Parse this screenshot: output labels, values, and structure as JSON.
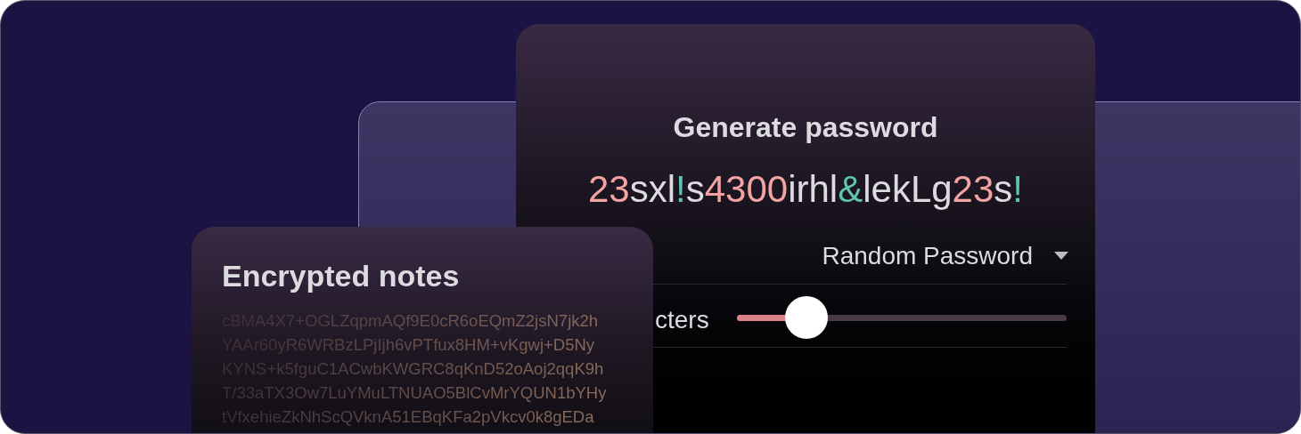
{
  "generator": {
    "title": "Generate password",
    "password": [
      {
        "text": "23",
        "kind": "digit"
      },
      {
        "text": "sxl",
        "kind": "letter"
      },
      {
        "text": "!",
        "kind": "symbol"
      },
      {
        "text": "s",
        "kind": "letter"
      },
      {
        "text": "4300",
        "kind": "digit"
      },
      {
        "text": "irhl",
        "kind": "letter"
      },
      {
        "text": "&",
        "kind": "symbol"
      },
      {
        "text": "lekLg",
        "kind": "letter"
      },
      {
        "text": "23",
        "kind": "digit"
      },
      {
        "text": "s",
        "kind": "letter"
      },
      {
        "text": "!",
        "kind": "symbol"
      }
    ],
    "type_select": {
      "value": "Random Password"
    },
    "length": {
      "label": "cters",
      "level": 0.21
    }
  },
  "notes": {
    "title": "Encrypted notes",
    "lines": [
      "cBMA4X7+OGLZqpmAQf9E0cR6oEQmZ2jsN7jk2h",
      "YAAr60yR6WRBzLPjIjh6vPTfux8HM+vKgwj+D5Ny",
      "KYNS+k5fguC1ACwbKWGRC8qKnD52oAoj2qqK9h",
      "T/33aTX3Ow7LuYMuLTNUAO5BlCvMrYQUN1bYHy",
      "tVfxehieZkNhScQVknA51EBqKFa2pVkcv0k8gEDa"
    ]
  }
}
